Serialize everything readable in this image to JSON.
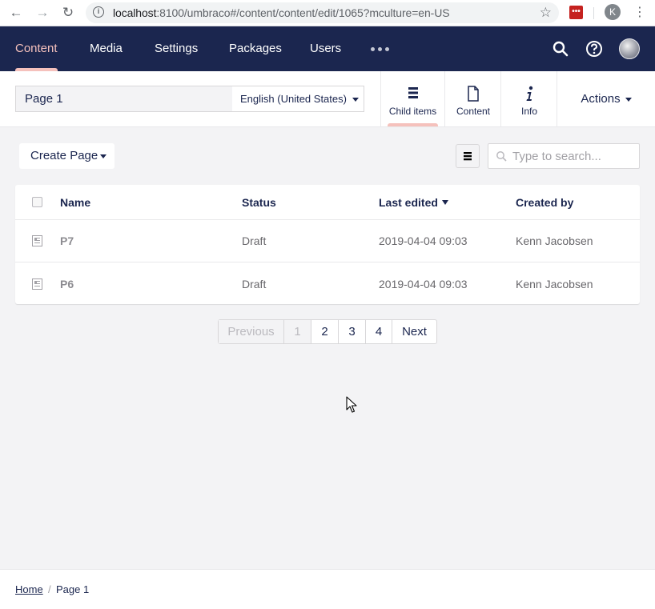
{
  "browser": {
    "url_host": "localhost",
    "url_rest": ":8100/umbraco#/content/content/edit/1065?mculture=en-US",
    "profile_initial": "K",
    "extension_label": "•••"
  },
  "sections": [
    {
      "label": "Content",
      "active": true
    },
    {
      "label": "Media"
    },
    {
      "label": "Settings"
    },
    {
      "label": "Packages"
    },
    {
      "label": "Users"
    }
  ],
  "editor": {
    "node_name": "Page 1",
    "culture": "English (United States)",
    "apps": [
      {
        "label": "Child items",
        "icon": "list-icon",
        "active": true
      },
      {
        "label": "Content",
        "icon": "document-icon"
      },
      {
        "label": "Info",
        "icon": "info-icon"
      }
    ],
    "actions_label": "Actions"
  },
  "toolbar": {
    "create_label": "Create Page",
    "search_placeholder": "Type to search..."
  },
  "table": {
    "columns": [
      "Name",
      "Status",
      "Last edited",
      "Created by"
    ],
    "rows": [
      {
        "name": "P7",
        "status": "Draft",
        "last_edited": "2019-04-04 09:03",
        "created_by": "Kenn Jacobsen"
      },
      {
        "name": "P6",
        "status": "Draft",
        "last_edited": "2019-04-04 09:03",
        "created_by": "Kenn Jacobsen"
      }
    ]
  },
  "pagination": {
    "previous": "Previous",
    "pages": [
      "1",
      "2",
      "3",
      "4"
    ],
    "current": "1",
    "next": "Next"
  },
  "breadcrumb": {
    "home": "Home",
    "separator": "/",
    "current": "Page 1"
  },
  "colors": {
    "header_bg": "#1b264f",
    "active_accent": "#f5c1bc",
    "body_bg": "#f3f3f5"
  }
}
